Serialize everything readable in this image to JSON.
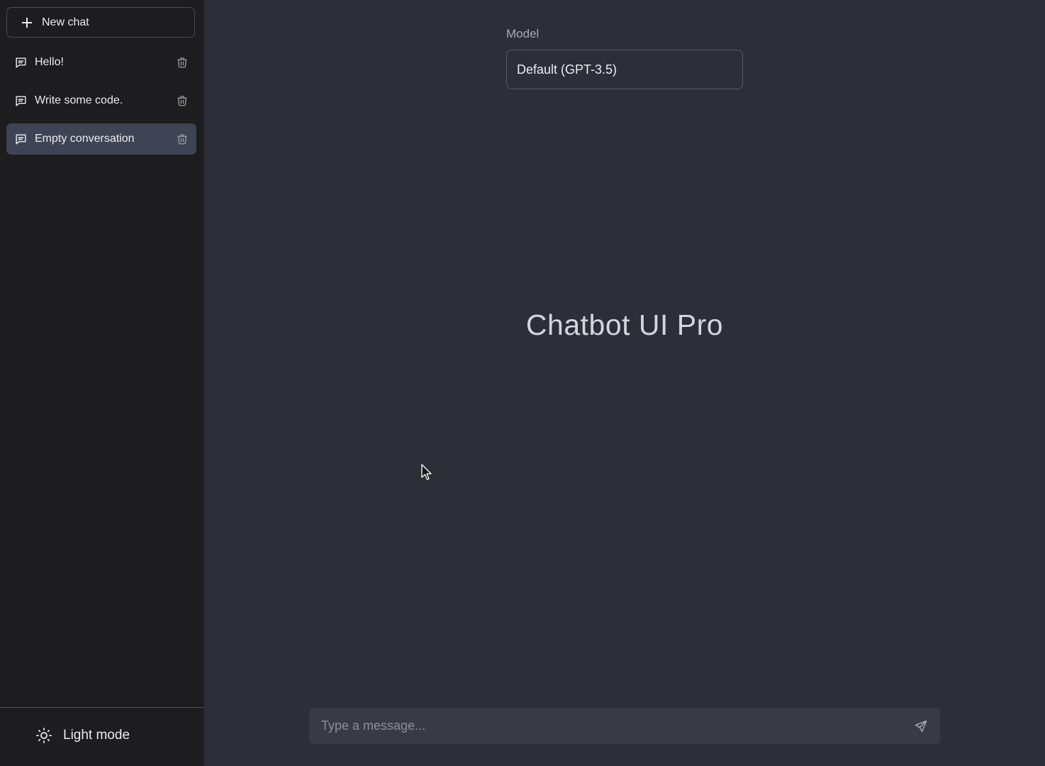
{
  "sidebar": {
    "new_chat_label": "New chat",
    "conversations": [
      {
        "label": "Hello!"
      },
      {
        "label": "Write some code."
      },
      {
        "label": "Empty conversation"
      }
    ],
    "footer": {
      "light_mode_label": "Light mode"
    }
  },
  "main": {
    "model_label": "Model",
    "model_value": "Default (GPT-3.5)",
    "title": "Chatbot UI Pro",
    "composer": {
      "placeholder": "Type a message..."
    }
  },
  "colors": {
    "sidebar_bg": "#1d1d1f",
    "main_bg": "#2e2e38",
    "selected_item": "#3f4454",
    "composer_bg": "#3a3a44"
  },
  "icons": [
    "plus-icon",
    "chat-bubble-icon",
    "trash-icon",
    "sun-icon",
    "send-icon",
    "mouse-cursor-icon"
  ]
}
